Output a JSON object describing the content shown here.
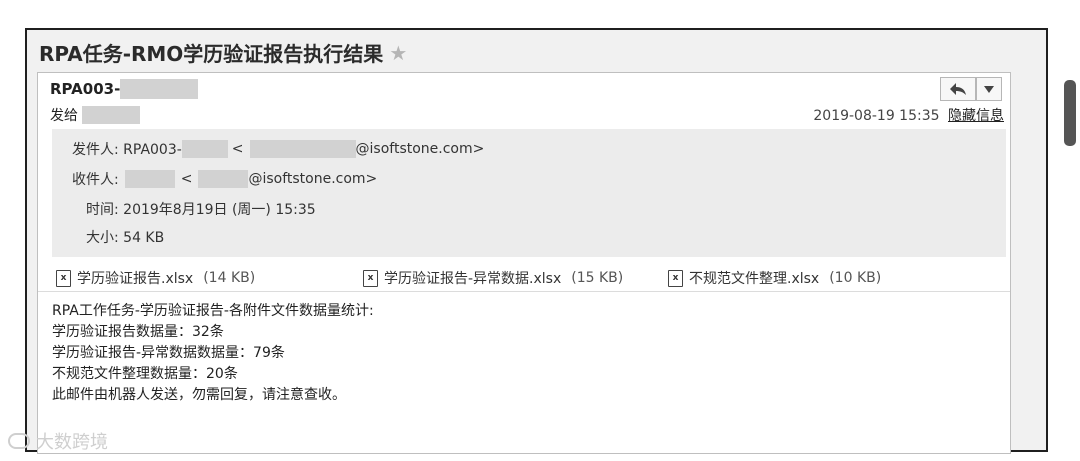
{
  "window": {
    "title": "RPA任务-RMO学历验证报告执行结果",
    "star_icon": "star-icon"
  },
  "email": {
    "subject": "RPA003-",
    "send_to_label": "发给",
    "date": "2019-08-19 15:35",
    "hide_info_link": "隐藏信息",
    "reply_icon": "reply-icon",
    "dropdown_icon": "chevron-down-icon"
  },
  "details": {
    "from_label": "发件人: RPA003-",
    "from_lt": "<",
    "from_domain": "@isoftstone.com>",
    "to_label": "收件人:",
    "to_lt": "<",
    "to_domain": "@isoftstone.com>",
    "time": "时间: 2019年8月19日 (周一) 15:35",
    "size": "大小: 54 KB"
  },
  "attachments": [
    {
      "name": "学历验证报告.xlsx",
      "size": "(14 KB)"
    },
    {
      "name": "学历验证报告-异常数据.xlsx",
      "size": "(15 KB)"
    },
    {
      "name": "不规范文件整理.xlsx",
      "size": "(10 KB)"
    }
  ],
  "body_lines": [
    "RPA工作任务-学历验证报告-各附件文件数据量统计:",
    "学历验证报告数据量：32条",
    "学历验证报告-异常数据数据量：79条",
    "不规范文件整理数据量：20条",
    "此邮件由机器人发送，勿需回复，请注意查收。"
  ],
  "watermark": "大数跨境"
}
